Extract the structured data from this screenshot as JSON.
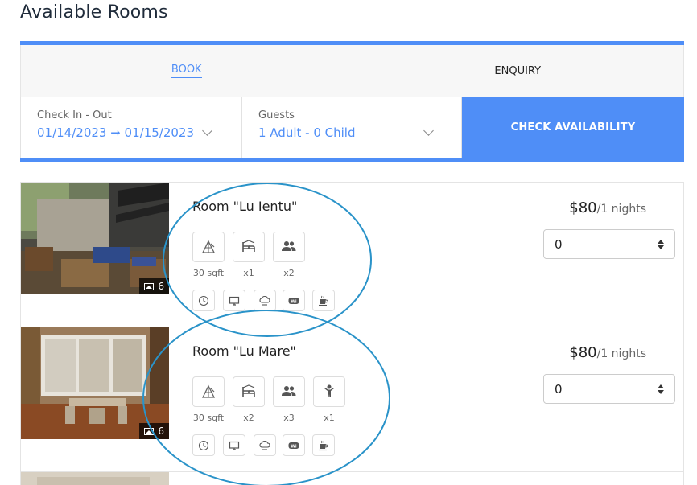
{
  "page_title": "Available Rooms",
  "tabs": [
    {
      "label": "BOOK",
      "active": true
    },
    {
      "label": "ENQUIRY",
      "active": false
    }
  ],
  "search": {
    "checkin_label": "Check In - Out",
    "checkin_value": "01/14/2023 ➞ 01/15/2023",
    "guests_label": "Guests",
    "guests_value": "1 Adult - 0 Child",
    "button_label": "CHECK AVAILABILITY"
  },
  "colors": {
    "accent": "#4f8ef7",
    "annotation": "#2a93c9"
  },
  "rooms": [
    {
      "name": "Room \"Lu Ientu\"",
      "photo_count": "6",
      "features": [
        {
          "icon": "area-icon",
          "caption": "30 sqft"
        },
        {
          "icon": "bed-icon",
          "caption": "x1"
        },
        {
          "icon": "adults-icon",
          "caption": "x2"
        }
      ],
      "amenities": [
        "clock-icon",
        "tv-icon",
        "air-conditioning-icon",
        "wifi-icon",
        "coffee-icon"
      ],
      "price": "$80",
      "price_unit": "/1 nights",
      "quantity": "0"
    },
    {
      "name": "Room \"Lu Mare\"",
      "photo_count": "6",
      "features": [
        {
          "icon": "area-icon",
          "caption": "30 sqft"
        },
        {
          "icon": "bed-icon",
          "caption": "x2"
        },
        {
          "icon": "adults-icon",
          "caption": "x3"
        },
        {
          "icon": "child-icon",
          "caption": "x1"
        }
      ],
      "amenities": [
        "clock-icon",
        "tv-icon",
        "air-conditioning-icon",
        "wifi-icon",
        "coffee-icon"
      ],
      "price": "$80",
      "price_unit": "/1 nights",
      "quantity": "0"
    }
  ]
}
